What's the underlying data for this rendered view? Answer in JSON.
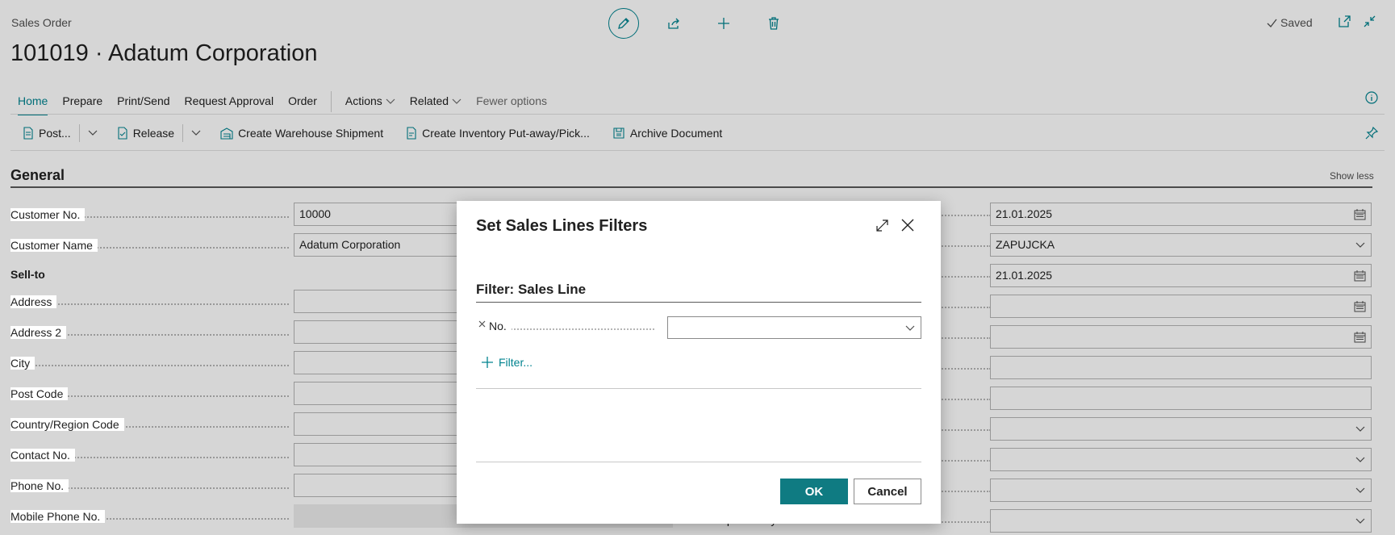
{
  "header": {
    "doc_type": "Sales Order",
    "title": "101019 · Adatum Corporation",
    "saved_label": "Saved"
  },
  "nav": {
    "tabs": [
      "Home",
      "Prepare",
      "Print/Send",
      "Request Approval",
      "Order"
    ],
    "actions": "Actions",
    "related": "Related",
    "fewer": "Fewer options"
  },
  "actionbar": {
    "post": "Post...",
    "release": "Release",
    "warehouse": "Create Warehouse Shipment",
    "inventory": "Create Inventory Put-away/Pick...",
    "archive": "Archive Document"
  },
  "general": {
    "title": "General",
    "show_less": "Show less",
    "sell_to": "Sell-to",
    "fields": [
      {
        "label": "Customer No.",
        "value": "10000"
      },
      {
        "label": "Customer Name",
        "value": "Adatum Corporation"
      },
      {
        "label": "Address",
        "value": ""
      },
      {
        "label": "Address 2",
        "value": ""
      },
      {
        "label": "City",
        "value": ""
      },
      {
        "label": "Post Code",
        "value": ""
      },
      {
        "label": "Country/Region Code",
        "value": ""
      },
      {
        "label": "Contact No.",
        "value": ""
      },
      {
        "label": "Phone No.",
        "value": ""
      },
      {
        "label": "Mobile Phone No.",
        "value": ""
      }
    ],
    "right_values": [
      "21.01.2025",
      "ZAPUJCKA",
      "21.01.2025",
      "",
      "",
      "",
      "",
      "",
      "",
      "",
      ""
    ],
    "bottom_label": "Responsibility Center"
  },
  "dialog": {
    "title": "Set Sales Lines Filters",
    "filter_heading": "Filter: Sales Line",
    "filter_field": "No.",
    "filter_value": "",
    "add_filter": "Filter...",
    "ok": "OK",
    "cancel": "Cancel"
  },
  "colors": {
    "accent": "#00838f",
    "ok_button": "#0f7b82"
  }
}
